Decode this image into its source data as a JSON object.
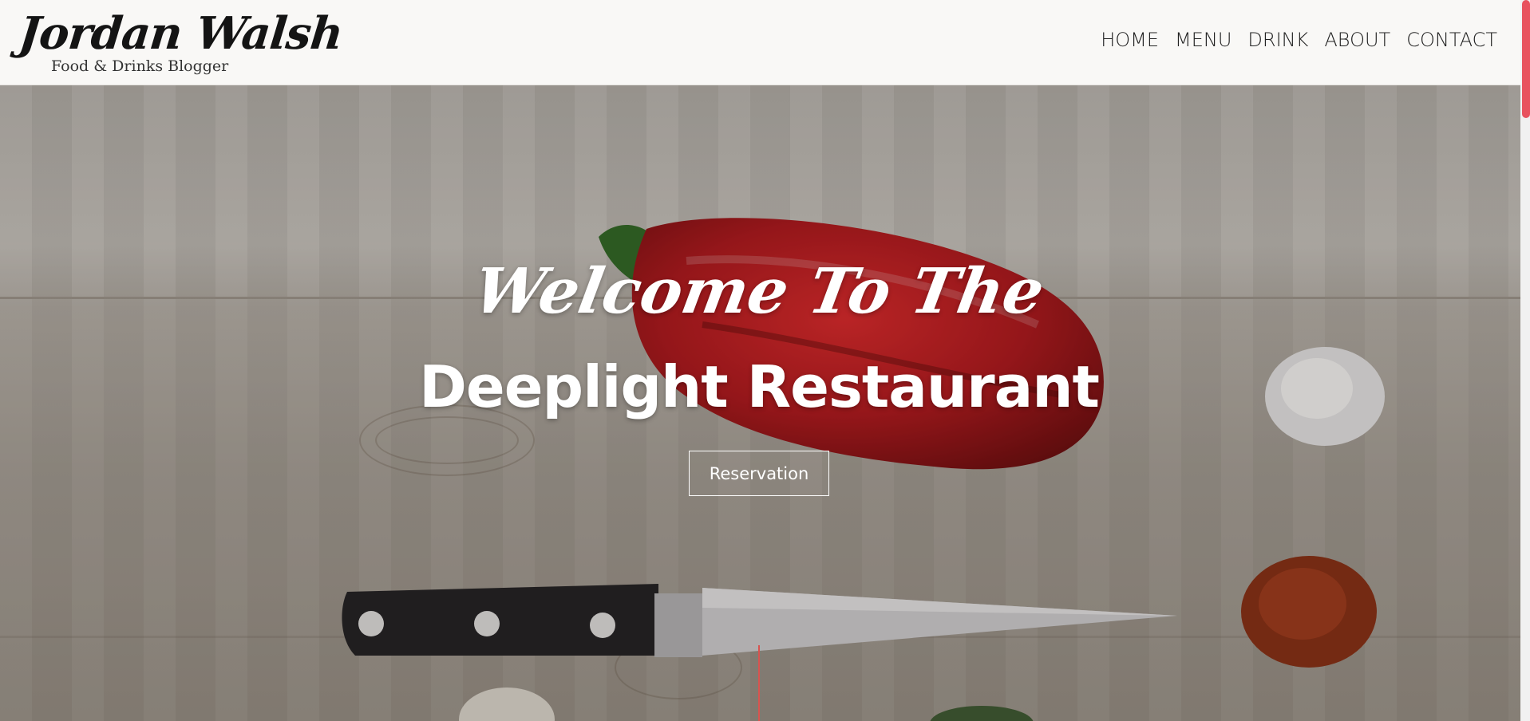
{
  "header": {
    "logo_title": "Jordan Walsh",
    "logo_subtitle": "Food & Drinks Blogger",
    "nav": [
      {
        "label": "HOME"
      },
      {
        "label": "MENU"
      },
      {
        "label": "DRINK"
      },
      {
        "label": "ABOUT"
      },
      {
        "label": "CONTACT"
      }
    ]
  },
  "hero": {
    "welcome_text": "Welcome To The",
    "restaurant_name": "Deeplight Restaurant",
    "cta_label": "Reservation"
  },
  "colors": {
    "accent": "#e8525e",
    "header_bg": "#f9f8f6",
    "hero_text": "#ffffff"
  },
  "icons": {
    "scroll_indicator": "scroll-down-line"
  }
}
